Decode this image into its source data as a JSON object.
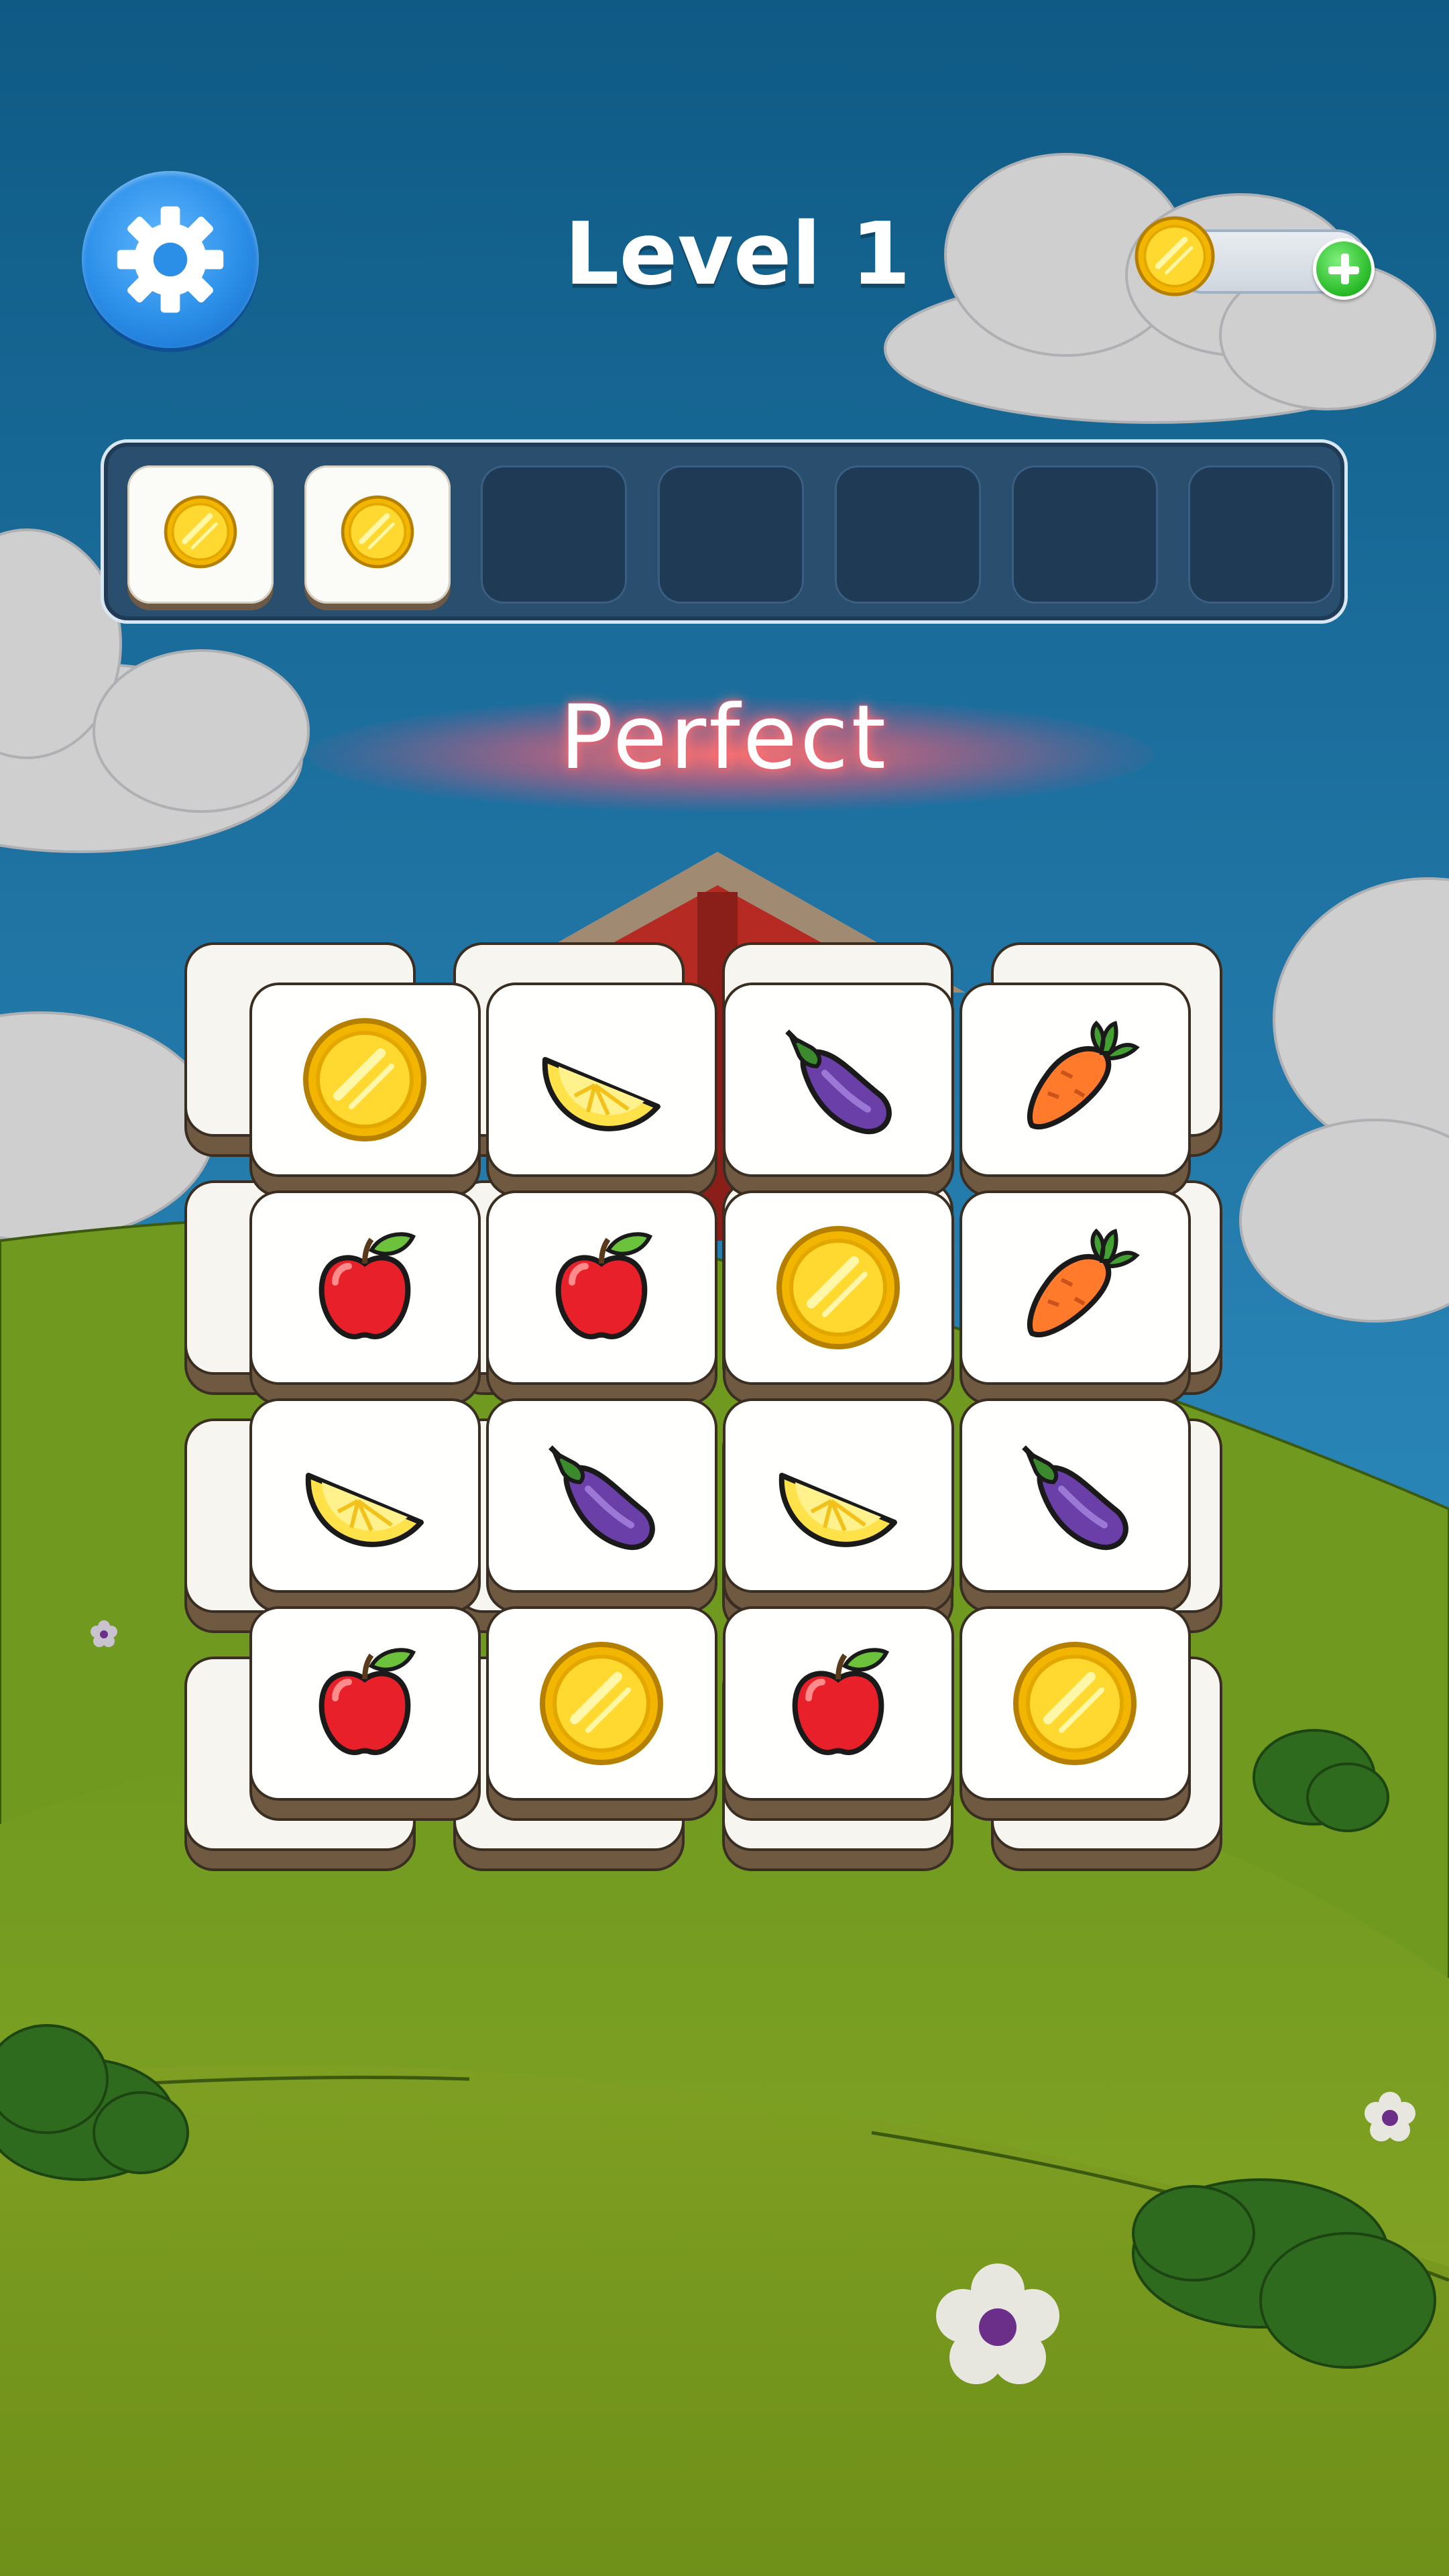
{
  "hud": {
    "level_title": "Level 1",
    "settings_icon": "gear-icon",
    "coin_icon": "coin-icon",
    "add_coins_icon": "plus-icon",
    "coin_amount": ""
  },
  "tray": {
    "capacity": 7,
    "slots": [
      "coin",
      "coin",
      "",
      "",
      "",
      "",
      ""
    ]
  },
  "feedback": {
    "message": "Perfect"
  },
  "board": {
    "top_layer": [
      [
        "coin",
        "lemon",
        "eggplant",
        "carrot"
      ],
      [
        "apple",
        "apple",
        "coin",
        "carrot"
      ],
      [
        "lemon",
        "eggplant",
        "lemon",
        "eggplant"
      ],
      [
        "apple",
        "coin",
        "apple",
        "coin"
      ]
    ],
    "bottom_layer_rows": 4,
    "bottom_layer_cols": 4
  },
  "scene": {
    "sky_color": "#1e6a9a",
    "grass_color": "#7fa825",
    "tile_face_color": "#fffffd",
    "tile_edge_color": "#6f5a41"
  }
}
